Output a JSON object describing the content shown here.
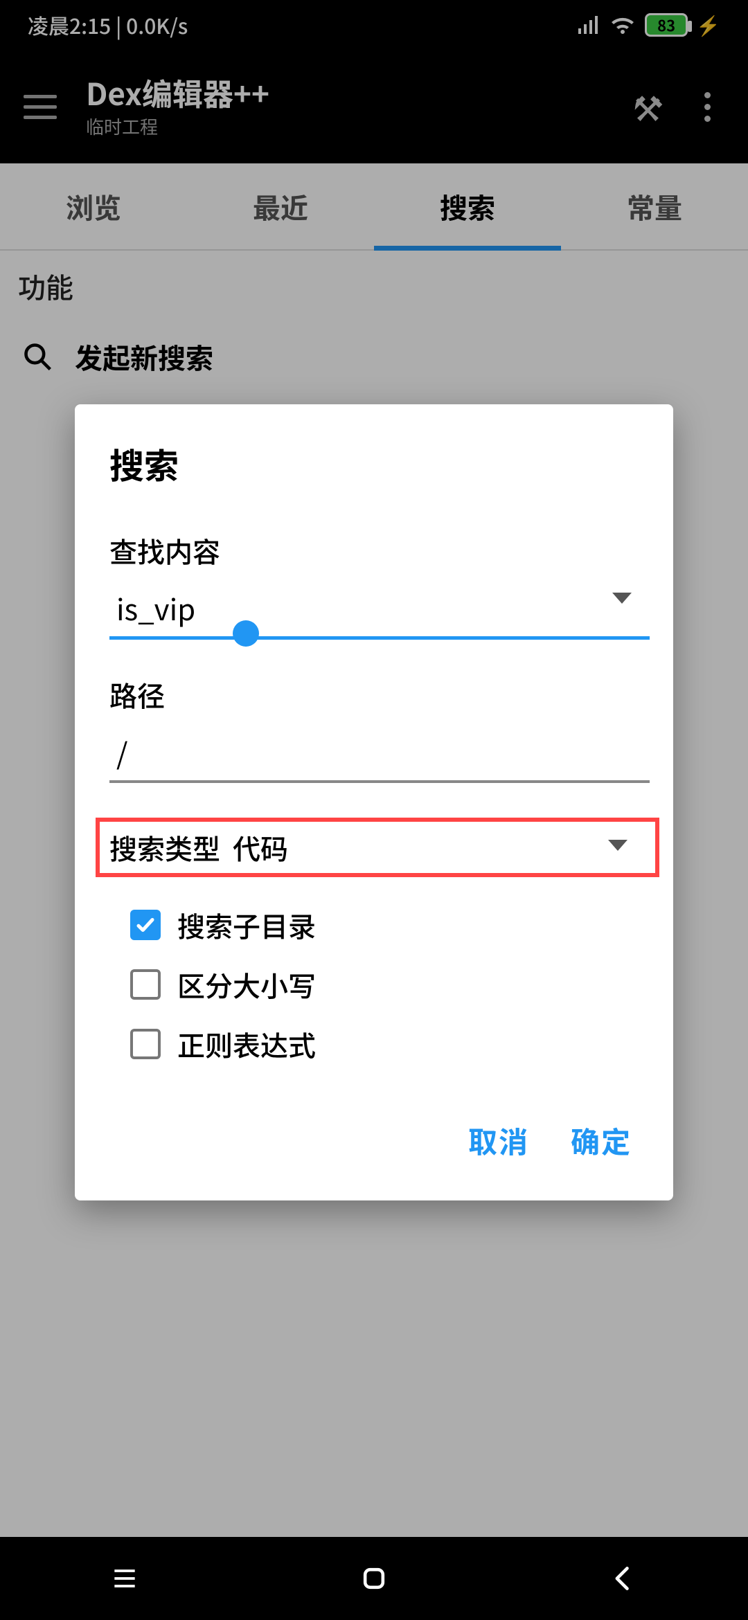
{
  "status": {
    "time_text": "凌晨2:15 | 0.0K/s",
    "battery_pct": "83"
  },
  "appbar": {
    "title": "Dex编辑器++",
    "subtitle": "临时工程"
  },
  "tabs": {
    "items": [
      "浏览",
      "最近",
      "搜索",
      "常量"
    ],
    "active_index": 2
  },
  "section": {
    "header": "功能",
    "new_search": "发起新搜索"
  },
  "dialog": {
    "title": "搜索",
    "find_label": "查找内容",
    "find_value": "is_vip",
    "path_label": "路径",
    "path_value": "/",
    "type_label": "搜索类型",
    "type_value": "代码",
    "checks": {
      "subdirs": {
        "label": "搜索子目录",
        "checked": true
      },
      "case": {
        "label": "区分大小写",
        "checked": false
      },
      "regex": {
        "label": "正则表达式",
        "checked": false
      }
    },
    "cancel": "取消",
    "ok": "确定"
  }
}
